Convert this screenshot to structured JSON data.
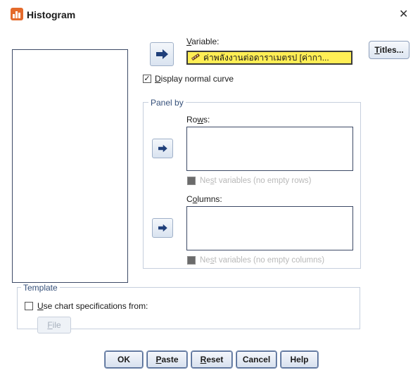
{
  "window": {
    "title": "Histogram",
    "close_glyph": "✕"
  },
  "variable": {
    "label_pre": "",
    "label_u": "V",
    "label_post": "ariable:",
    "value": "ค่าพลังงานต่อดาราเมตรป [ค่ากา..."
  },
  "titles_button": {
    "u": "T",
    "rest": "itles..."
  },
  "display_normal_curve": {
    "checked": true,
    "u": "D",
    "rest": "isplay normal curve"
  },
  "panel_by": {
    "legend": "Panel by",
    "rows_label_pre": "Ro",
    "rows_label_u": "w",
    "rows_label_post": "s:",
    "rows_nest": {
      "pre": "Ne",
      "u": "s",
      "post": "t variables (no empty rows)"
    },
    "columns_label_pre": "C",
    "columns_label_u": "o",
    "columns_label_post": "lumns:",
    "columns_nest": {
      "pre": "Ne",
      "u": "s",
      "post": "t variables (no empty columns)"
    }
  },
  "template": {
    "legend": "Template",
    "use_chart": {
      "checked": false,
      "u": "U",
      "rest": "se chart specifications from:"
    },
    "file_button": {
      "u": "F",
      "rest": "ile"
    }
  },
  "buttons": {
    "ok": "OK",
    "paste": {
      "u": "P",
      "rest": "aste"
    },
    "reset": {
      "u": "R",
      "rest": "eset"
    },
    "cancel": "Cancel",
    "help": "Help"
  },
  "colors": {
    "variable_bg": "#ffee55",
    "accent": "#35507a"
  },
  "icons": {
    "app": "histogram-app-icon",
    "move_arrow": "right-arrow-icon",
    "variable_type": "ruler-scale-icon"
  }
}
